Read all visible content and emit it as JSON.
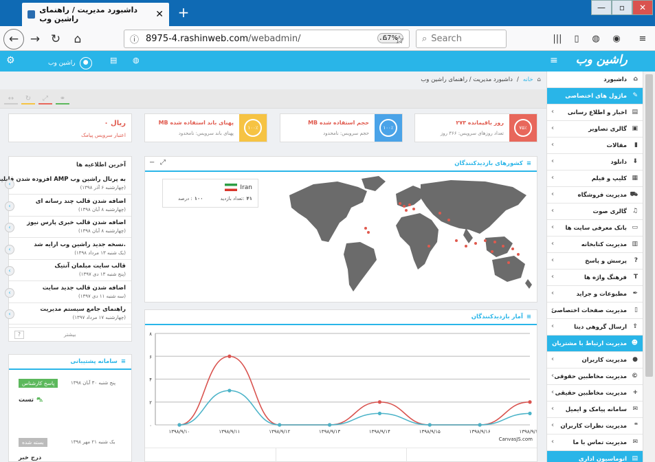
{
  "browser": {
    "tab_title": "داشبورد مدیریت / راهنمای راشین وب",
    "url_domain": "8975-4.rashinweb.com",
    "url_path": "/webadmin/",
    "zoom": "67%",
    "search_placeholder": "Search"
  },
  "topbar": {
    "brand": "راشین وب",
    "user": "راشین وب"
  },
  "breadcrumb": {
    "home": "خانه",
    "sep": "/",
    "current": "داشبورد مدیریت / راهنمای راشین وب"
  },
  "stats": [
    {
      "value": "۲۷۳ روز باقیمانده",
      "sub": "تعداد روزهای سرویس: ۳۶۶ روز",
      "pct": "۷۵٪",
      "color": "#e8675b"
    },
    {
      "value": "MB حجم استفاده شده",
      "sub": "حجم سرویس: نامحدود",
      "pct": "۱۰۰٪",
      "color": "#4aa3e8"
    },
    {
      "value": "MB پهنای باند استفاده شده",
      "sub": "پهنای باند سرویس: نامحدود",
      "pct": "۱۰۰٪",
      "color": "#f6c343"
    }
  ],
  "credit": {
    "value": "۰ ریال",
    "label": "اعتبار سرویس پیامک"
  },
  "news": {
    "title": "آخرین اطلاعیه ها",
    "more": "بیشتر",
    "help": "?",
    "items": [
      {
        "title": "افزوده شدن قابلیت AMP به پرتال راشین وب",
        "date": "(چهارشنبه ۶ آذر ۱۳۹۸)"
      },
      {
        "title": "اضافه شدن قالب چند رسانه ای",
        "date": "(چهارشنبه ۸ آبان ۱۳۹۸)"
      },
      {
        "title": "اضافه شدن قالب خبری پارس نیوز",
        "date": "(چهارشنبه ۸ آبان ۱۳۹۸)"
      },
      {
        "title": "نسخه جدید راشین وب ارایه شد.",
        "date": "(یک شنبه ۱۳ مرداد ۱۳۹۸)"
      },
      {
        "title": "قالب سایت مبلمان آنتیک",
        "date": "(پنج شنبه ۱۳ دی ۱۳۹۷)"
      },
      {
        "title": "اضافه شدن قالب جدید سایت",
        "date": "(سه شنبه ۱۱ دی ۱۳۹۷)"
      },
      {
        "title": "راهنمای جامع سیستم مدیریت",
        "date": "(چهارشنبه ۱۷ مرداد ۱۳۹۷)"
      }
    ]
  },
  "support": {
    "title": "سامانه پشتیبانی",
    "t1_date": "پنج شنبه ۳۰ آبان ۱۳۹۸",
    "t1_badge": "پاسخ کارشناس",
    "t1_text": "تست",
    "t2_date": "یک شنبه ۲۱ مهر ۱۳۹۸",
    "t2_badge": "بسته شده",
    "t2_text": "درج خبر"
  },
  "map": {
    "title": "کشورهای بازدیدکنندگان",
    "country": "Iran",
    "visits_label": "تعداد بازدید:",
    "visits": "۴۱",
    "percent_label": "درصد :",
    "percent": "۱۰۰"
  },
  "chart_panel": {
    "title": "آمار بازدیدکنندگان",
    "credit": "CanvasJS.com"
  },
  "chart_data": {
    "type": "line",
    "categories": [
      "۱۳۹۸/۹/۱۰",
      "۱۳۹۸/۹/۱۱",
      "۱۳۹۸/۹/۱۲",
      "۱۳۹۸/۹/۱۳",
      "۱۳۹۸/۹/۱۴",
      "۱۳۹۸/۹/۱۵",
      "۱۳۹۸/۹/۱۶",
      "۱۳۹۸/۹/۱۷"
    ],
    "y_ticks": [
      "۰",
      "۲",
      "۴",
      "۶",
      "۸"
    ],
    "ylim": [
      0,
      8
    ],
    "series": [
      {
        "values": [
          0,
          6,
          0,
          0,
          2,
          0,
          0,
          2
        ],
        "color": "#d9534f"
      },
      {
        "values": [
          0,
          3,
          0,
          0,
          1,
          0,
          0,
          1
        ],
        "color": "#4bb3c8"
      }
    ],
    "grid": true
  },
  "sidebar": {
    "items": [
      {
        "label": "داشبورد",
        "icon": "home-icon",
        "glyph": "⌂",
        "head": false,
        "chev": false
      },
      {
        "label": "ماژول های اختصاصی",
        "icon": "pencil-icon",
        "glyph": "✎",
        "head": true,
        "chev": false
      },
      {
        "label": "اخبار و اطلاع رسانی",
        "icon": "news-icon",
        "glyph": "▤",
        "head": false,
        "chev": true
      },
      {
        "label": "گالری تصاویر",
        "icon": "image-icon",
        "glyph": "▣",
        "head": false,
        "chev": true
      },
      {
        "label": "مقالات",
        "icon": "file-icon",
        "glyph": "▮",
        "head": false,
        "chev": true
      },
      {
        "label": "دانلود",
        "icon": "download-icon",
        "glyph": "⬇",
        "head": false,
        "chev": true
      },
      {
        "label": "کلیپ و فیلم",
        "icon": "film-icon",
        "glyph": "▦",
        "head": false,
        "chev": true
      },
      {
        "label": "مدیریت فروشگاه",
        "icon": "cart-icon",
        "glyph": "⛟",
        "head": false,
        "chev": true
      },
      {
        "label": "گالری صوت",
        "icon": "audio-icon",
        "glyph": "♫",
        "head": false,
        "chev": true
      },
      {
        "label": "بانک معرفی سایت ها",
        "icon": "monitor-icon",
        "glyph": "▭",
        "head": false,
        "chev": true
      },
      {
        "label": "مدیریت کتابخانه",
        "icon": "book-icon",
        "glyph": "▥",
        "head": false,
        "chev": true
      },
      {
        "label": "پرسش و پاسخ",
        "icon": "question-icon",
        "glyph": "?",
        "head": false,
        "chev": true
      },
      {
        "label": "فرهنگ واژه ها",
        "icon": "text-icon",
        "glyph": "T",
        "head": false,
        "chev": true
      },
      {
        "label": "مطبوعات و جراید",
        "icon": "pen-icon",
        "glyph": "✒",
        "head": false,
        "chev": true
      },
      {
        "label": "مدیریت صفحات اختصاصی",
        "icon": "page-icon",
        "glyph": "▯",
        "head": false,
        "chev": true
      },
      {
        "label": "ارسال گروهی دیتا",
        "icon": "send-icon",
        "glyph": "⇪",
        "head": false,
        "chev": true
      },
      {
        "label": "مدیریت ارتباط با مشتریان",
        "icon": "users-icon",
        "glyph": "☻",
        "head": true,
        "chev": false
      },
      {
        "label": "مدیریت کاربران",
        "icon": "user-icon",
        "glyph": "●",
        "head": false,
        "chev": true
      },
      {
        "label": "مدیریت مخاطبین حقوقی",
        "icon": "copyright-icon",
        "glyph": "©",
        "head": false,
        "chev": true
      },
      {
        "label": "مدیریت مخاطبین حقیقی",
        "icon": "user-plus-icon",
        "glyph": "+",
        "head": false,
        "chev": true
      },
      {
        "label": "سامانه پیامک و ایمیل",
        "icon": "envelope-icon",
        "glyph": "✉",
        "head": false,
        "chev": true
      },
      {
        "label": "مدیریت نظرات کاربران",
        "icon": "comment-icon",
        "glyph": "❝",
        "head": false,
        "chev": true
      },
      {
        "label": "مدیریت تماس با ما",
        "icon": "mail-icon",
        "glyph": "✉",
        "head": false,
        "chev": true
      },
      {
        "label": "اتوماسیون اداری",
        "icon": "office-icon",
        "glyph": "▤",
        "head": true,
        "chev": false
      }
    ]
  }
}
